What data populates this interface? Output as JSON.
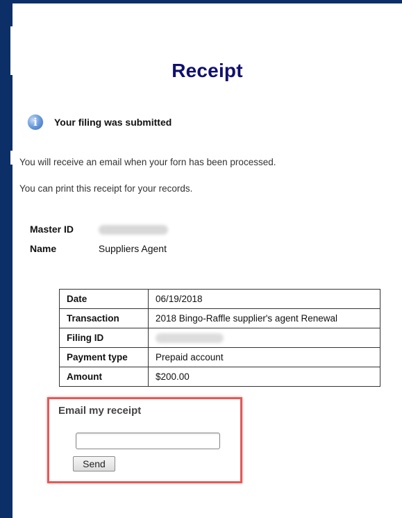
{
  "title": "Receipt",
  "notice": {
    "icon": "info-icon",
    "text": "Your filing was submitted"
  },
  "messages": [
    "You will receive an email when your forn has been processed.",
    "You can print this receipt for your records."
  ],
  "identity": {
    "master_id_label": "Master ID",
    "name_label": "Name",
    "name_value": "Suppliers Agent"
  },
  "receipt_table": [
    {
      "label": "Date",
      "value": "06/19/2018"
    },
    {
      "label": "Transaction",
      "value": "2018 Bingo-Raffle supplier's agent Renewal"
    },
    {
      "label": "Filing ID",
      "value": ""
    },
    {
      "label": "Payment type",
      "value": "Prepaid account"
    },
    {
      "label": "Amount",
      "value": "$200.00"
    }
  ],
  "email": {
    "title": "Email my receipt",
    "input_value": "",
    "send_label": "Send"
  },
  "colors": {
    "frame": "#0b2f66",
    "title": "#101070",
    "highlight": "#e25a5a"
  }
}
